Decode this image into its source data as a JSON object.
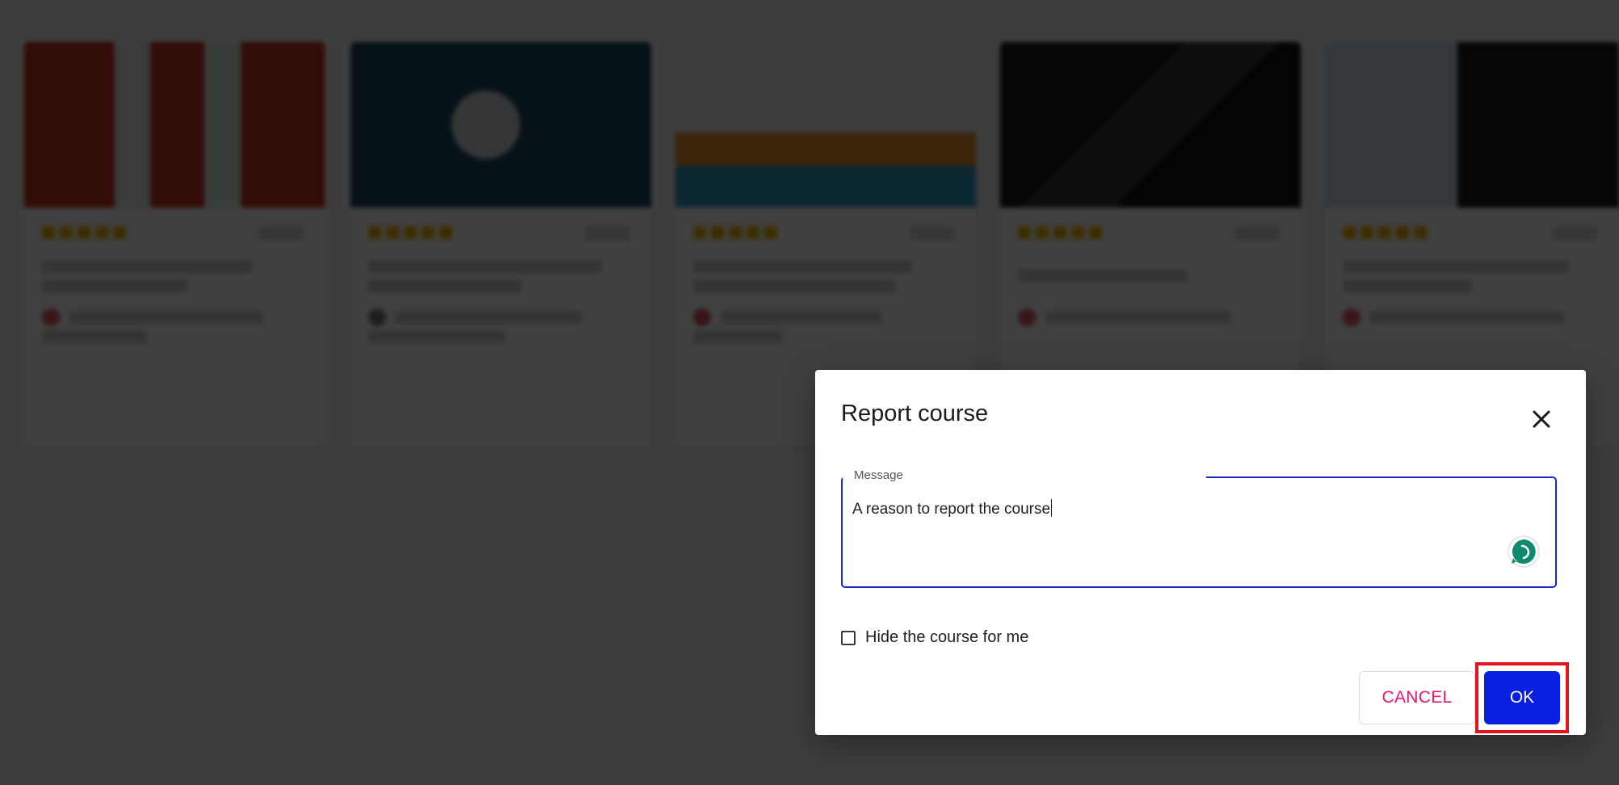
{
  "dialog": {
    "title": "Report course",
    "message_label": "Message",
    "message_value": "A reason to report the course",
    "hide_label": "Hide the course for me",
    "hide_checked": false,
    "cancel_label": "CANCEL",
    "ok_label": "OK"
  },
  "icons": {
    "close": "close-icon",
    "extension": "speech-bubble-icon"
  },
  "colors": {
    "primary": "#0a1fe0",
    "cancel_text": "#e8186f",
    "focus_border": "#1a27c4",
    "highlight": "#e3141f",
    "overlay": "rgba(0,0,0,0.75)"
  }
}
